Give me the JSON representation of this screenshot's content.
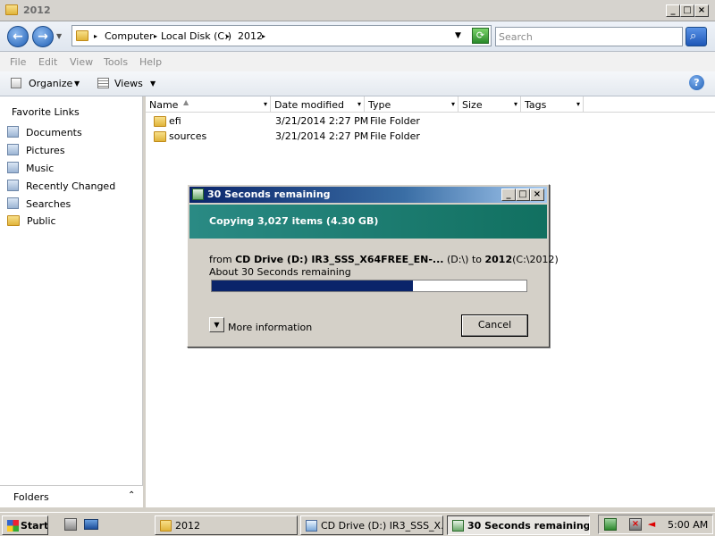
{
  "window": {
    "title": "2012"
  },
  "nav": {
    "breadcrumb": [
      "Computer",
      "Local Disk (C:)",
      "2012"
    ],
    "search_placeholder": "Search"
  },
  "menu": [
    "File",
    "Edit",
    "View",
    "Tools",
    "Help"
  ],
  "toolbar": {
    "organize": "Organize",
    "views": "Views"
  },
  "sidebar": {
    "heading": "Favorite Links",
    "items": [
      {
        "label": "Documents",
        "icon": "documents-icon"
      },
      {
        "label": "Pictures",
        "icon": "pictures-icon"
      },
      {
        "label": "Music",
        "icon": "music-icon"
      },
      {
        "label": "Recently Changed",
        "icon": "recent-icon"
      },
      {
        "label": "Searches",
        "icon": "searches-icon"
      },
      {
        "label": "Public",
        "icon": "folder-icon"
      }
    ],
    "folders_label": "Folders"
  },
  "file_list": {
    "columns": [
      "Name",
      "Date modified",
      "Type",
      "Size",
      "Tags"
    ],
    "rows": [
      {
        "name": "efi",
        "date": "3/21/2014 2:27 PM",
        "type": "File Folder"
      },
      {
        "name": "sources",
        "date": "3/21/2014 2:27 PM",
        "type": "File Folder"
      }
    ]
  },
  "copy_dialog": {
    "title": "30 Seconds remaining",
    "heading": "Copying 3,027 items (4.30 GB)",
    "from_prefix": "from",
    "source": "CD Drive (D:) IR3_SSS_X64FREE_EN-...",
    "source_path": "(D:\\)",
    "to_word": "to",
    "dest": "2012",
    "dest_path": "(C:\\2012)",
    "remaining": "About 30 Seconds remaining",
    "progress_fraction": 0.64,
    "more_info": "More information",
    "cancel": "Cancel"
  },
  "taskbar": {
    "start": "Start",
    "tasks": [
      {
        "label": "2012",
        "active": false
      },
      {
        "label": "CD Drive (D:) IR3_SSS_X...",
        "active": false
      },
      {
        "label": "30 Seconds remaining",
        "active": true
      }
    ],
    "clock": "5:00 AM"
  },
  "colors": {
    "progress": "#0a246a",
    "dialog_header": "#117060",
    "title_active": "#0a246a"
  }
}
